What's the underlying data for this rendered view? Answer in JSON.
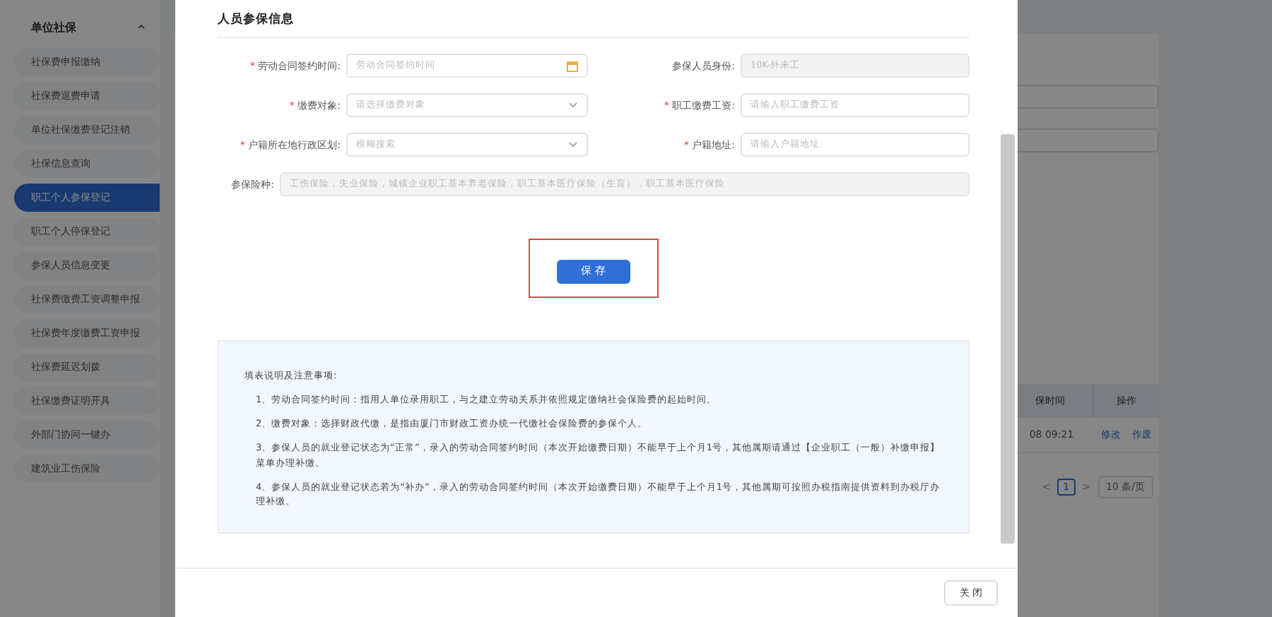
{
  "sidebar": {
    "group": {
      "title": "单位社保",
      "expanded": true
    },
    "items": [
      {
        "label": "社保费申报缴纳",
        "selected": false
      },
      {
        "label": "社保费退费申请",
        "selected": false
      },
      {
        "label": "单位社保缴费登记注销",
        "selected": false
      },
      {
        "label": "社保信息查询",
        "selected": false
      },
      {
        "label": "职工个人参保登记",
        "selected": true
      },
      {
        "label": "职工个人停保登记",
        "selected": false
      },
      {
        "label": "参保人员信息变更",
        "selected": false
      },
      {
        "label": "社保费缴费工资调整申报",
        "selected": false
      },
      {
        "label": "社保费年度缴费工资申报",
        "selected": false
      },
      {
        "label": "社保费延迟划拨",
        "selected": false
      },
      {
        "label": "社保缴费证明开具",
        "selected": false
      },
      {
        "label": "外部门协同一键办",
        "selected": false
      },
      {
        "label": "建筑业工伤保险",
        "selected": false
      }
    ]
  },
  "background_table": {
    "columns": [
      "保时间",
      "操作"
    ],
    "rows": [
      {
        "time": "08 09:21",
        "actions": [
          "修改",
          "作废"
        ]
      }
    ],
    "pagination": {
      "prev": "<",
      "pages": [
        {
          "label": "1",
          "selected": true
        }
      ],
      "next": ">",
      "page_size": "10 条/页"
    }
  },
  "dialog": {
    "section_title": "人员参保信息",
    "fields": [
      {
        "kind": "date",
        "required_mark": "*",
        "label": "劳动合同签约时间:",
        "required": true,
        "placeholder": "劳动合同签约时间",
        "disabled": false
      },
      {
        "kind": "text",
        "label": "参保人员身份:",
        "required": false,
        "value": "10K-外来工",
        "disabled": true
      },
      {
        "kind": "select",
        "label": "缴费对象:",
        "required": true,
        "required_mark": "*",
        "placeholder": "请选择缴费对象",
        "disabled": false
      },
      {
        "kind": "text",
        "label": "职工缴费工资:",
        "required": true,
        "required_mark": "*",
        "placeholder": "请输入职工缴费工资",
        "disabled": false
      },
      {
        "kind": "select",
        "label": "户籍所在地行政区划:",
        "required": true,
        "required_mark": "*",
        "placeholder": "模糊搜索",
        "disabled": false
      },
      {
        "kind": "text",
        "label": "户籍地址:",
        "required": true,
        "required_mark": "*",
        "placeholder": "请输入户籍地址",
        "disabled": false
      },
      {
        "kind": "wide",
        "label": "参保险种:",
        "required": false,
        "placeholder": "工伤保险，失业保险，城镇企业职工基本养老保险，职工基本医疗保险（生育），职工基本医疗保险",
        "disabled": true
      }
    ],
    "save_button": "保 存",
    "notes": {
      "title": "填表说明及注意事项:",
      "items": [
        "1、劳动合同签约时间：指用人单位录用职工，与之建立劳动关系并依照规定缴纳社会保险费的起始时间。",
        "2、缴费对象：选择财政代缴，是指由厦门市财政工资办统一代缴社会保险费的参保个人。",
        "3、参保人员的就业登记状态为“正常”，录入的劳动合同签约时间（本次开始缴费日期）不能早于上个月1号，其他属期请通过【企业职工（一般）补缴申报】菜单办理补缴。",
        "4、参保人员的就业登记状态若为“补办”，录入的劳动合同签约时间（本次开始缴费日期）不能早于上个月1号，其他属期可按照办税指南提供资料到办税厅办理补缴。"
      ]
    },
    "close_button": "关 闭"
  }
}
